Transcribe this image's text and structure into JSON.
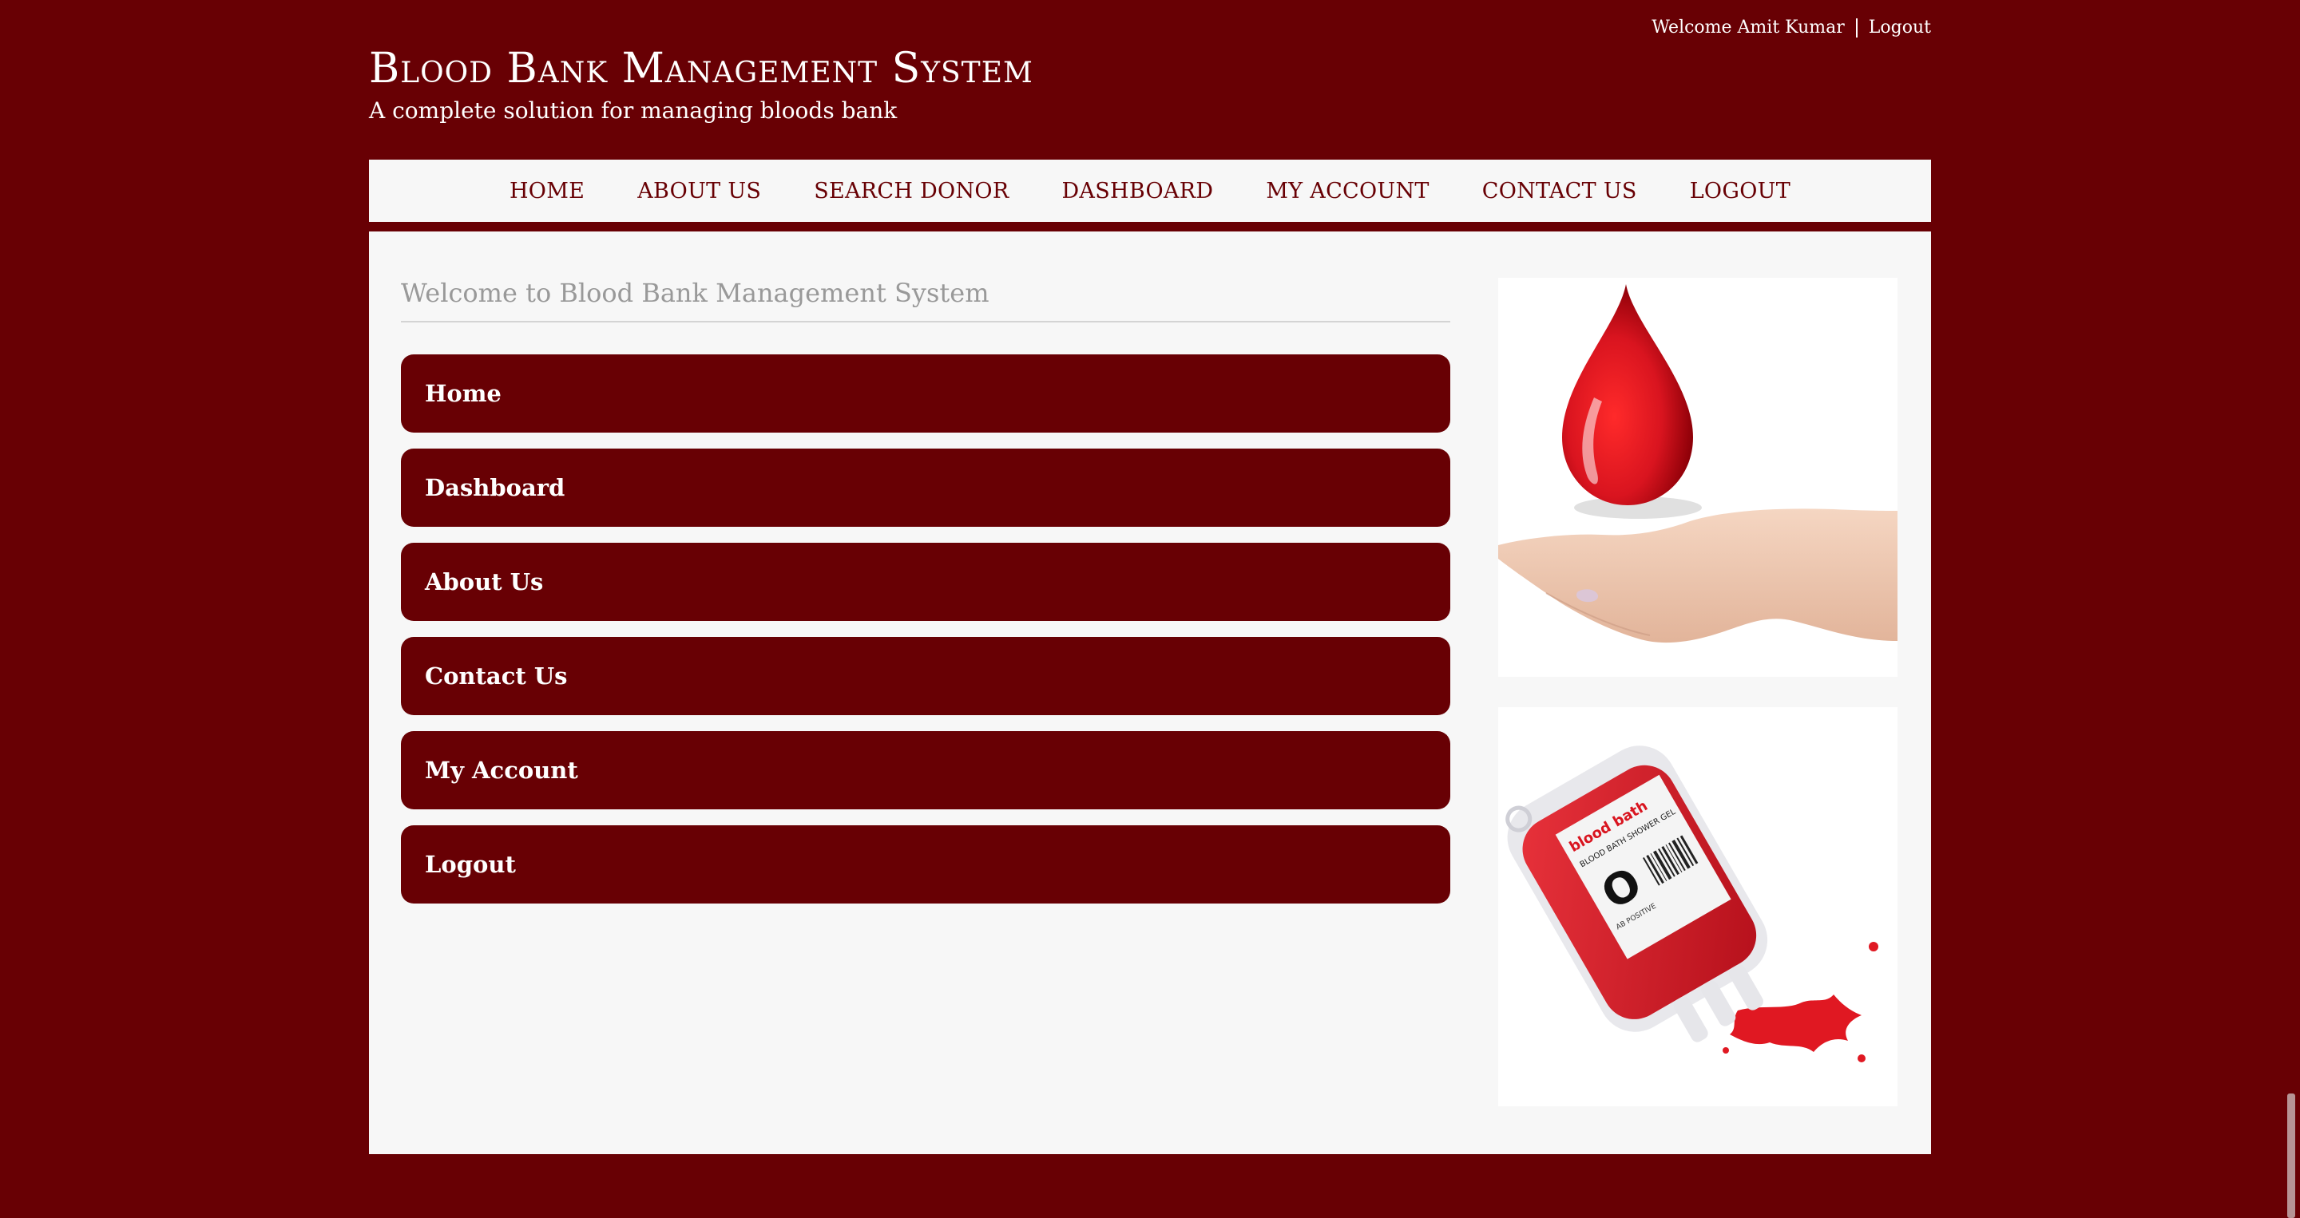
{
  "topbar": {
    "welcome": "Welcome Amit Kumar",
    "logout": "Logout"
  },
  "header": {
    "title": "Blood Bank Management System",
    "subtitle": "A complete solution for managing bloods bank"
  },
  "nav": {
    "items": [
      "HOME",
      "ABOUT US",
      "SEARCH DONOR",
      "DASHBOARD",
      "MY ACCOUNT",
      "CONTACT US",
      "LOGOUT"
    ]
  },
  "main": {
    "welcome": "Welcome to Blood Bank Management System",
    "menu": [
      "Home",
      "Dashboard",
      "About Us",
      "Contact Us",
      "My Account",
      "Logout"
    ]
  },
  "images": {
    "blood_bag": {
      "brand": "blood bath",
      "label_title": "BLOOD BATH SHOWER GEL",
      "type": "O",
      "type_note": "AB POSITIVE"
    }
  },
  "colors": {
    "brand": "#680004",
    "panel": "#f7f7f7",
    "blood": "#d9141f"
  }
}
